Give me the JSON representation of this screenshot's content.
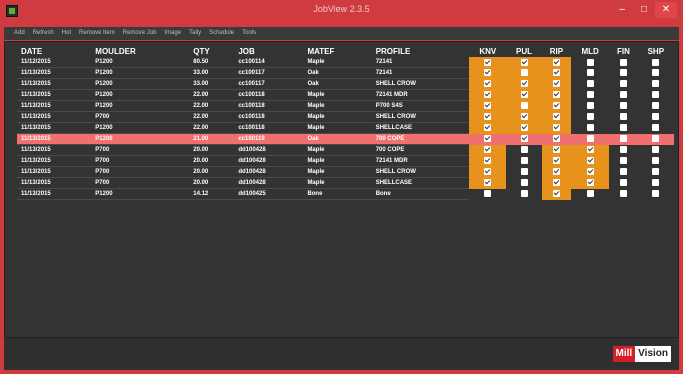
{
  "window": {
    "title": "JobView 2.3.5"
  },
  "menu": [
    "Add",
    "Refresh",
    "Hot",
    "Remove Item",
    "Remove Job",
    "Image",
    "Tally",
    "Schedule",
    "Tools"
  ],
  "table": {
    "headers": [
      "DATE",
      "MOULDER",
      "QTY",
      "JOB",
      "MATEF",
      "PROFILE",
      "KNV",
      "PUL",
      "RIP",
      "MLD",
      "FIN",
      "SHP"
    ],
    "rows": [
      {
        "date": "11/12/2015",
        "moulder": "P1200",
        "qty": "80.50",
        "job": "cc100114",
        "mat": "Maple",
        "profile": "72141",
        "knv": true,
        "pul": true,
        "rip": true,
        "mld": false,
        "fin": false,
        "shp": false
      },
      {
        "date": "11/13/2015",
        "moulder": "P1200",
        "qty": "33.00",
        "job": "cc100117",
        "mat": "Oak",
        "profile": "72141",
        "knv": true,
        "pul": false,
        "rip": true,
        "mld": false,
        "fin": false,
        "shp": false
      },
      {
        "date": "11/13/2015",
        "moulder": "P1200",
        "qty": "33.00",
        "job": "cc100117",
        "mat": "Oak",
        "profile": "SHELL CROW",
        "knv": true,
        "pul": true,
        "rip": true,
        "mld": false,
        "fin": false,
        "shp": false
      },
      {
        "date": "11/13/2015",
        "moulder": "P1200",
        "qty": "22.00",
        "job": "cc100118",
        "mat": "Maple",
        "profile": "72141 MDR",
        "knv": true,
        "pul": true,
        "rip": true,
        "mld": false,
        "fin": false,
        "shp": false
      },
      {
        "date": "11/13/2015",
        "moulder": "P1200",
        "qty": "22.00",
        "job": "cc100118",
        "mat": "Maple",
        "profile": "P700 S4S",
        "knv": true,
        "pul": false,
        "rip": true,
        "mld": false,
        "fin": false,
        "shp": false
      },
      {
        "date": "11/13/2015",
        "moulder": "P700",
        "qty": "22.00",
        "job": "cc100118",
        "mat": "Maple",
        "profile": "SHELL CROW",
        "knv": true,
        "pul": true,
        "rip": true,
        "mld": false,
        "fin": false,
        "shp": false
      },
      {
        "date": "11/13/2015",
        "moulder": "P1200",
        "qty": "22.00",
        "job": "cc100118",
        "mat": "Maple",
        "profile": "SHELLCASE",
        "knv": true,
        "pul": true,
        "rip": true,
        "mld": false,
        "fin": false,
        "shp": false
      },
      {
        "date": "11/13/2015",
        "moulder": "P1200",
        "qty": "21.00",
        "job": "cc100119",
        "mat": "Oak",
        "profile": "700 COPE",
        "knv": true,
        "pul": true,
        "rip": true,
        "mld": false,
        "fin": false,
        "shp": false,
        "selected": true
      },
      {
        "date": "11/13/2015",
        "moulder": "P700",
        "qty": "20.00",
        "job": "dd100428",
        "mat": "Maple",
        "profile": "700 COPE",
        "knv": true,
        "pul": false,
        "rip": true,
        "mld": true,
        "fin": false,
        "shp": false
      },
      {
        "date": "11/13/2015",
        "moulder": "P700",
        "qty": "20.00",
        "job": "dd100428",
        "mat": "Maple",
        "profile": "72141 MDR",
        "knv": true,
        "pul": false,
        "rip": true,
        "mld": true,
        "fin": false,
        "shp": false
      },
      {
        "date": "11/13/2015",
        "moulder": "P700",
        "qty": "20.00",
        "job": "dd100428",
        "mat": "Maple",
        "profile": "SHELL CROW",
        "knv": true,
        "pul": false,
        "rip": true,
        "mld": true,
        "fin": false,
        "shp": false
      },
      {
        "date": "11/13/2015",
        "moulder": "P700",
        "qty": "20.00",
        "job": "dd100428",
        "mat": "Maple",
        "profile": "SHELLCASE",
        "knv": true,
        "pul": false,
        "rip": true,
        "mld": true,
        "fin": false,
        "shp": false
      },
      {
        "date": "11/13/2015",
        "moulder": "P1200",
        "qty": "14.12",
        "job": "dd100425",
        "mat": "Bone",
        "profile": "Bone",
        "knv": false,
        "pul": false,
        "rip": true,
        "mld": false,
        "fin": false,
        "shp": false
      }
    ]
  },
  "logo": {
    "part1": "Mill",
    "part2": "Vision"
  },
  "colors": {
    "accent": "#cf3b3e",
    "highlight": "#e8921e",
    "selected_row": "#f07070"
  }
}
